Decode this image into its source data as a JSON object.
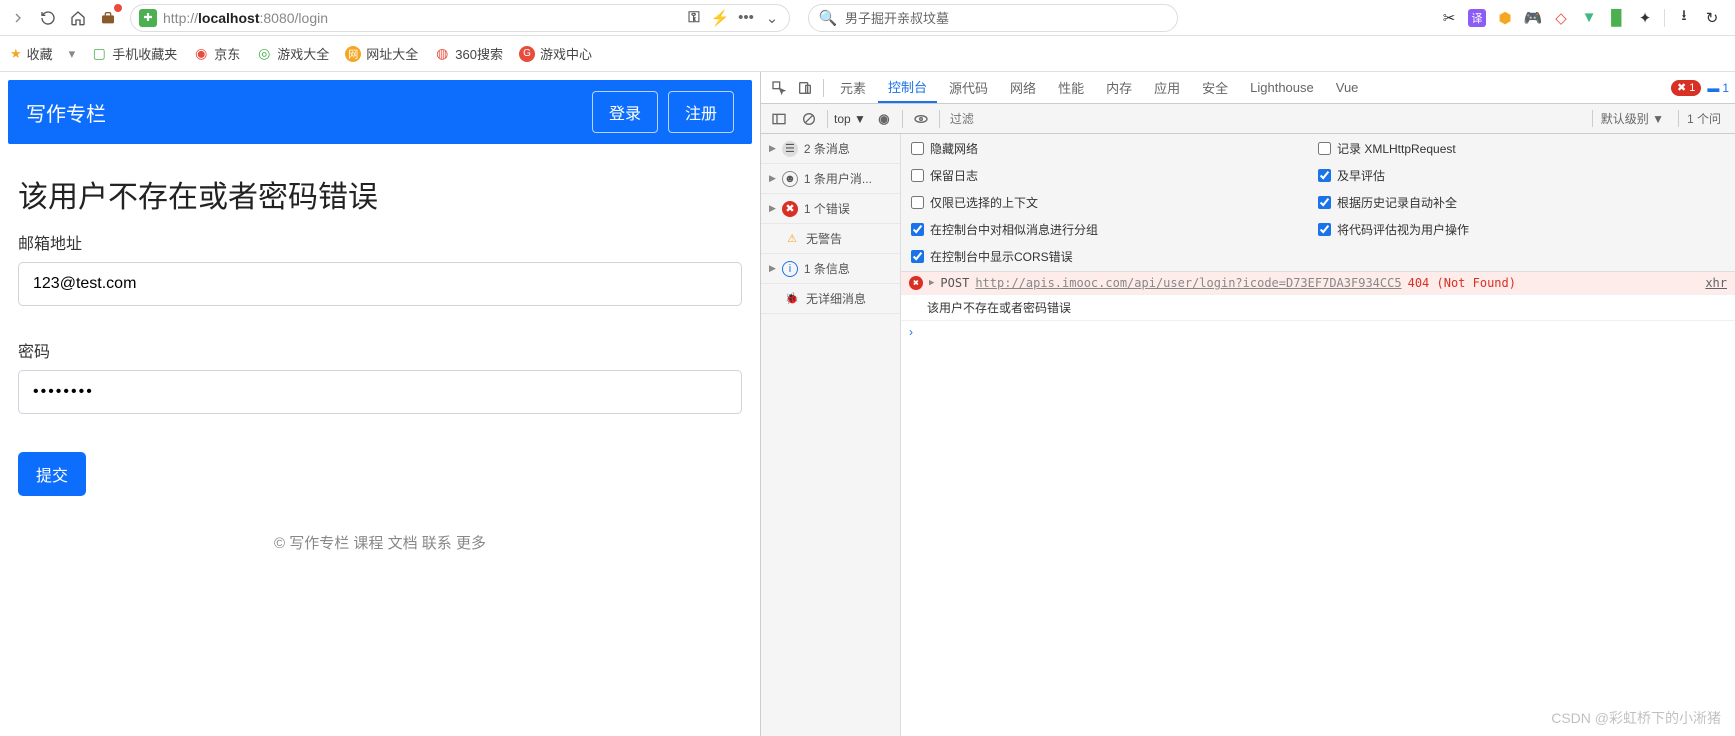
{
  "browser": {
    "url_pre": "http://",
    "url_host": "localhost",
    "url_rest": ":8080/login",
    "search_text": "男子掘开亲叔坟墓",
    "bookmarks_bar": {
      "fav": "收藏",
      "mobile": "手机收藏夹",
      "jd": "京东",
      "games": "游戏大全",
      "sites": "网址大全",
      "search360": "360搜索",
      "gamecenter": "游戏中心"
    }
  },
  "page": {
    "brand": "写作专栏",
    "login": "登录",
    "register": "注册",
    "heading": "该用户不存在或者密码错误",
    "email_label": "邮箱地址",
    "email_value": "123@test.com",
    "pw_label": "密码",
    "pw_value": "••••••••",
    "submit": "提交",
    "footer": "© 写作专栏  课程  文档  联系  更多"
  },
  "devtools": {
    "tabs": {
      "elements": "元素",
      "console": "控制台",
      "sources": "源代码",
      "network": "网络",
      "performance": "性能",
      "memory": "内存",
      "application": "应用",
      "security": "安全",
      "lighthouse": "Lighthouse",
      "vue": "Vue"
    },
    "err_count": "1",
    "msg_count": "1",
    "toolbar": {
      "context": "top ▼",
      "filter_placeholder": "过滤",
      "level": "默认级别 ▼",
      "issues": "1 个问"
    },
    "sidebar": {
      "msgs": "2 条消息",
      "user": "1 条用户消...",
      "err": "1 个错误",
      "warn": "无警告",
      "info": "1 条信息",
      "verbose": "无详细消息"
    },
    "checks": {
      "hide_network": "隐藏网络",
      "preserve_log": "保留日志",
      "selected_ctx": "仅限已选择的上下文",
      "group_similar": "在控制台中对相似消息进行分组",
      "show_cors": "在控制台中显示CORS错误",
      "log_xhr": "记录 XMLHttpRequest",
      "eager": "及早评估",
      "autocomplete": "根据历史记录自动补全",
      "user_gesture": "将代码评估视为用户操作"
    },
    "error": {
      "method": "POST",
      "url": "http://apis.imooc.com/api/user/login?icode=D73EF7DA3F934CC5",
      "status": "404 (Not Found)",
      "source": "xhr"
    },
    "message": "该用户不存在或者密码错误"
  },
  "watermark": "CSDN @彩虹桥下的小淅猪"
}
